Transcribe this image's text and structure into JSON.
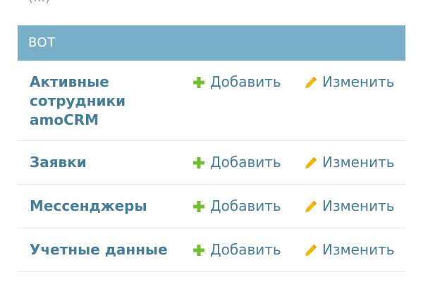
{
  "top_text": "(...)",
  "section": {
    "caption": "BOT",
    "rows": [
      {
        "name": "Активные сотрудники amoCRM",
        "add_label": "Добавить",
        "change_label": "Изменить"
      },
      {
        "name": "Заявки",
        "add_label": "Добавить",
        "change_label": "Изменить"
      },
      {
        "name": "Мессенджеры",
        "add_label": "Добавить",
        "change_label": "Изменить"
      },
      {
        "name": "Учетные данные",
        "add_label": "Добавить",
        "change_label": "Изменить"
      }
    ]
  },
  "icons": {
    "add": "plus-icon",
    "change": "pencil-icon"
  },
  "colors": {
    "caption_bg": "#79aec8",
    "link": "#447e9b",
    "add_icon": "#70bf2b",
    "change_icon": "#efb80b"
  }
}
